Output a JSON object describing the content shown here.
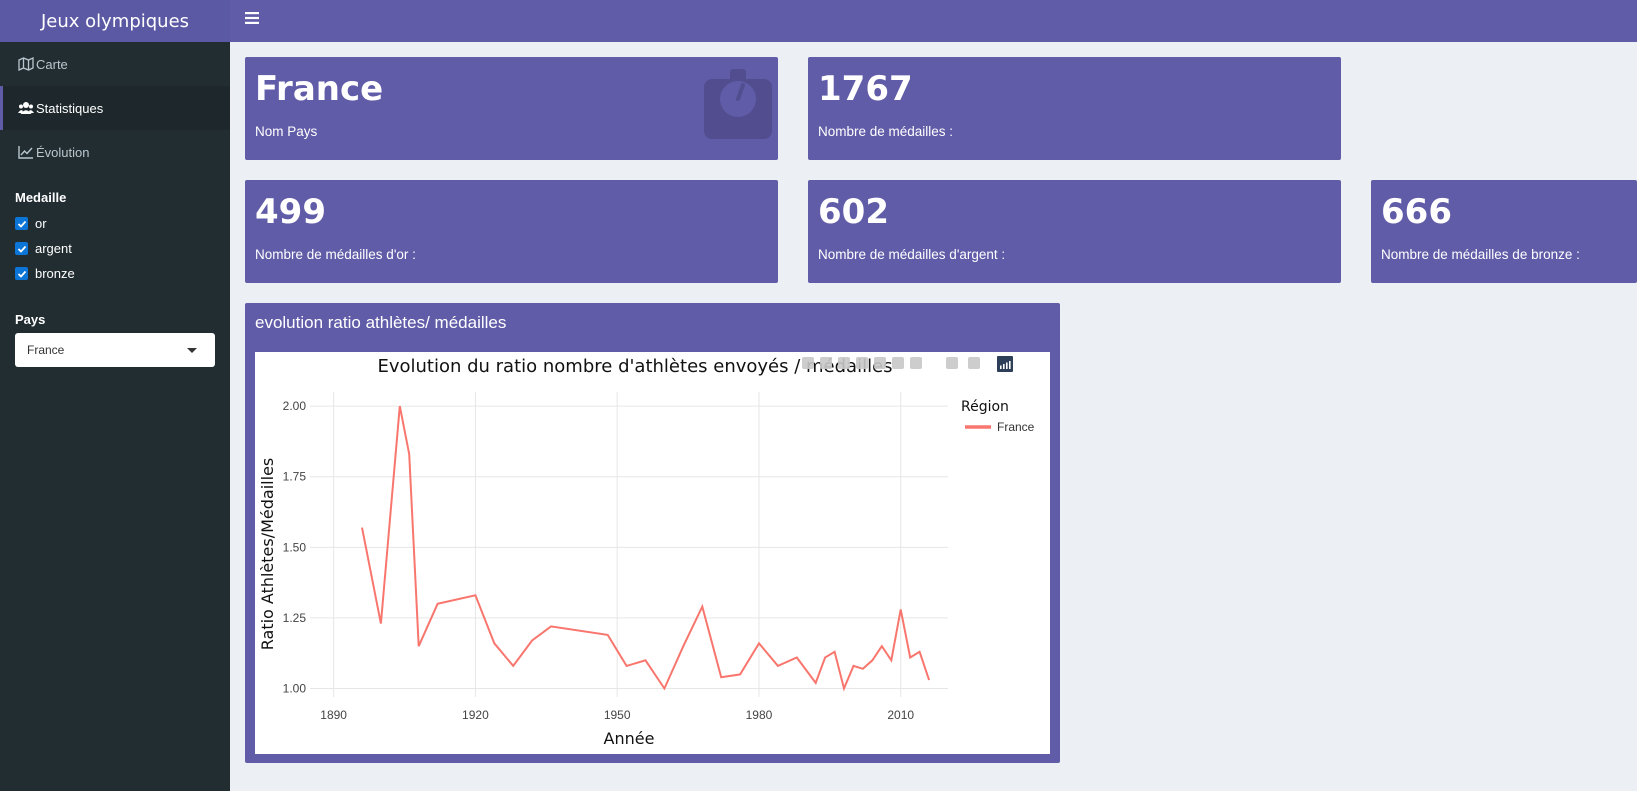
{
  "brand": {
    "title": "Jeux olympiques"
  },
  "sidebar": {
    "menu": [
      {
        "label": "Carte",
        "icon": "map-icon"
      },
      {
        "label": "Statistiques",
        "icon": "users-icon"
      },
      {
        "label": "Évolution",
        "icon": "line-chart-icon"
      }
    ],
    "medal_filter": {
      "label": "Medaille",
      "options": [
        {
          "label": "or",
          "checked": true
        },
        {
          "label": "argent",
          "checked": true
        },
        {
          "label": "bronze",
          "checked": true
        }
      ]
    },
    "country_filter": {
      "label": "Pays",
      "selected": "France"
    }
  },
  "value_boxes": {
    "country": {
      "value": "France",
      "label": "Nom Pays",
      "icon": "balance-scale-icon"
    },
    "total": {
      "value": "1767",
      "label": "Nombre de médailles :"
    },
    "gold": {
      "value": "499",
      "label": "Nombre de médailles d'or :"
    },
    "silver": {
      "value": "602",
      "label": "Nombre de médailles d'argent :"
    },
    "bronze": {
      "value": "666",
      "label": "Nombre de médailles de bronze :"
    }
  },
  "chart_box": {
    "title": "evolution ratio athlètes/ médailles"
  },
  "colors": {
    "primary": "#605ca8",
    "sidebar": "#222d32",
    "line": "#f8766d"
  },
  "chart_data": {
    "type": "line",
    "title": "Evolution du ratio nombre d'athlètes envoyés / médailles",
    "xlabel": "Année",
    "ylabel": "Ratio Athlètes/Médailles",
    "xlim": [
      1885,
      2020
    ],
    "ylim": [
      0.97,
      2.05
    ],
    "xticks": [
      1890,
      1920,
      1950,
      1980,
      2010
    ],
    "yticks": [
      "1.00",
      "1.25",
      "1.50",
      "1.75",
      "2.00"
    ],
    "legend_title": "Région",
    "legend_position": "top-right",
    "grid": true,
    "series": [
      {
        "name": "France",
        "x": [
          1896,
          1900,
          1904,
          1906,
          1908,
          1912,
          1920,
          1924,
          1928,
          1932,
          1936,
          1948,
          1952,
          1956,
          1960,
          1964,
          1968,
          1972,
          1976,
          1980,
          1984,
          1988,
          1992,
          1994,
          1996,
          1998,
          2000,
          2002,
          2004,
          2006,
          2008,
          2010,
          2012,
          2014,
          2016
        ],
        "y": [
          1.57,
          1.23,
          2.0,
          1.83,
          1.15,
          1.3,
          1.33,
          1.16,
          1.08,
          1.17,
          1.22,
          1.19,
          1.08,
          1.1,
          1.0,
          1.15,
          1.29,
          1.04,
          1.05,
          1.16,
          1.08,
          1.11,
          1.02,
          1.11,
          1.13,
          1.0,
          1.08,
          1.07,
          1.1,
          1.15,
          1.1,
          1.28,
          1.11,
          1.13,
          1.03
        ]
      }
    ]
  }
}
